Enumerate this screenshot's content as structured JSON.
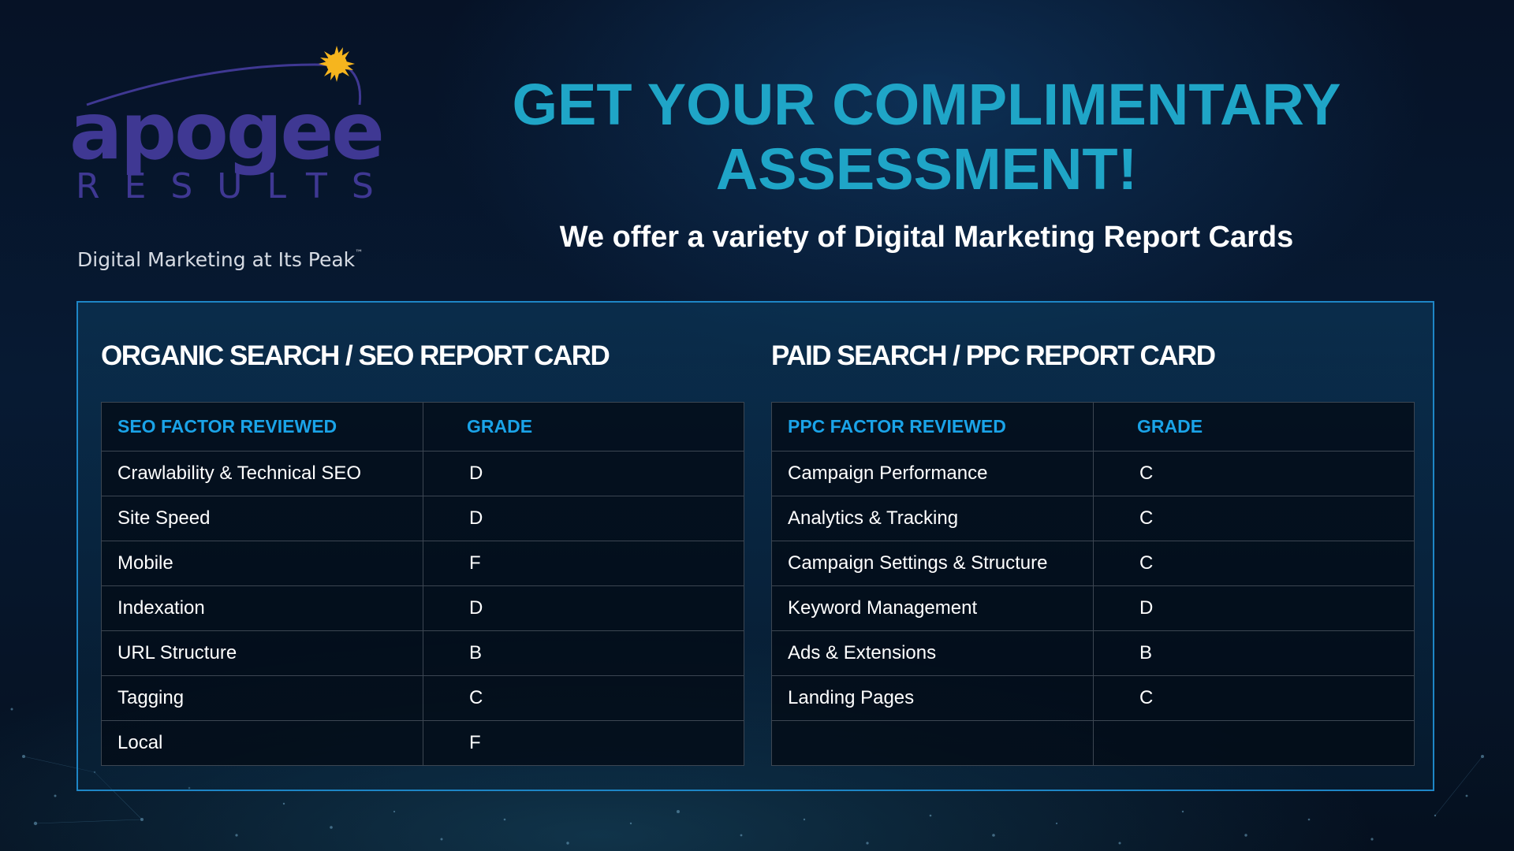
{
  "logo": {
    "wordmark": "apogee",
    "subtitle": "RESULTS",
    "tagline": "Digital Marketing at Its Peak",
    "trademark": "™",
    "colors": {
      "wordmark": "#3f3893",
      "sun": "#f6b51e",
      "tagline": "#d6dbe3"
    }
  },
  "header": {
    "headline": "GET YOUR COMPLIMENTARY ASSESSMENT!",
    "subheadline": "We offer a variety of Digital Marketing Report Cards",
    "colors": {
      "headline": "#1fa5c7"
    }
  },
  "seo_card": {
    "title": "ORGANIC SEARCH / SEO REPORT CARD",
    "col_factor": "SEO FACTOR REVIEWED",
    "col_grade": "GRADE",
    "rows": [
      {
        "factor": "Crawlability & Technical SEO",
        "grade": "D"
      },
      {
        "factor": "Site Speed",
        "grade": "D"
      },
      {
        "factor": "Mobile",
        "grade": "F"
      },
      {
        "factor": "Indexation",
        "grade": "D"
      },
      {
        "factor": "URL Structure",
        "grade": "B"
      },
      {
        "factor": "Tagging",
        "grade": "C"
      },
      {
        "factor": "Local",
        "grade": "F"
      }
    ]
  },
  "ppc_card": {
    "title": "PAID SEARCH / PPC REPORT CARD",
    "col_factor": "PPC FACTOR REVIEWED",
    "col_grade": "GRADE",
    "rows": [
      {
        "factor": "Campaign Performance",
        "grade": "C"
      },
      {
        "factor": "Analytics & Tracking",
        "grade": "C"
      },
      {
        "factor": "Campaign Settings & Structure",
        "grade": "C"
      },
      {
        "factor": "Keyword Management",
        "grade": "D"
      },
      {
        "factor": "Ads & Extensions",
        "grade": "B"
      },
      {
        "factor": "Landing Pages",
        "grade": "C"
      },
      {
        "factor": "",
        "grade": ""
      }
    ]
  },
  "colors": {
    "panel_border": "#1e86c6",
    "table_header_text": "#1aa3e8",
    "background": "#061226"
  }
}
